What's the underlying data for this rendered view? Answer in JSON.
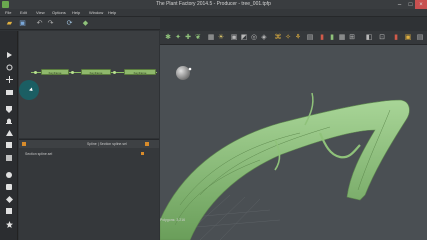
{
  "window": {
    "title": "The Plant Factory 2014.5 - Producer - tree_001.tpfp"
  },
  "menu": [
    {
      "label": "File"
    },
    {
      "label": "Edit"
    },
    {
      "label": "View"
    },
    {
      "label": "Options"
    },
    {
      "label": "Help"
    },
    {
      "label": "Window"
    },
    {
      "label": "Help"
    }
  ],
  "node_graph": {
    "nodes": [
      {
        "label": "Keyframe"
      },
      {
        "label": "Keyframe"
      },
      {
        "label": "Keyframe"
      }
    ]
  },
  "lower_panel": {
    "tab_label": "Spline | Section spline.sel",
    "item_label": "Section spline.sel"
  },
  "viewport": {
    "info_label": "Polygons: 3,216"
  },
  "colors": {
    "plant_green": "#8fc27a",
    "accent_orange": "#d98c2b",
    "node_green": "#8fb86c",
    "background": "#2f3235"
  },
  "icons": {
    "left_toolbar": [
      "folder-icon",
      "save-icon",
      "undo-icon",
      "redo-icon",
      "refresh-icon",
      "render-icon"
    ],
    "tool_strip": [
      "arrow-icon",
      "rotate-icon",
      "move-icon",
      "camera-icon",
      "shield-icon",
      "bell-icon",
      "triangle-icon",
      "grid-icon",
      "circle-icon",
      "lock-icon",
      "gear-icon",
      "diamond-icon",
      "cube-icon",
      "star-icon"
    ],
    "viewport_toolbar": [
      "orbit-icon",
      "pan-icon",
      "zoom-icon",
      "leaf-icon",
      "frame-icon",
      "light-icon",
      "camera-view-icon",
      "select-icon",
      "lasso-icon",
      "brush-icon",
      "wire-icon",
      "shade-icon",
      "texture-icon",
      "bone-icon",
      "red-marker-icon",
      "green-marker-icon",
      "grid-toggle-icon",
      "axis-icon",
      "render-preview-icon"
    ]
  }
}
